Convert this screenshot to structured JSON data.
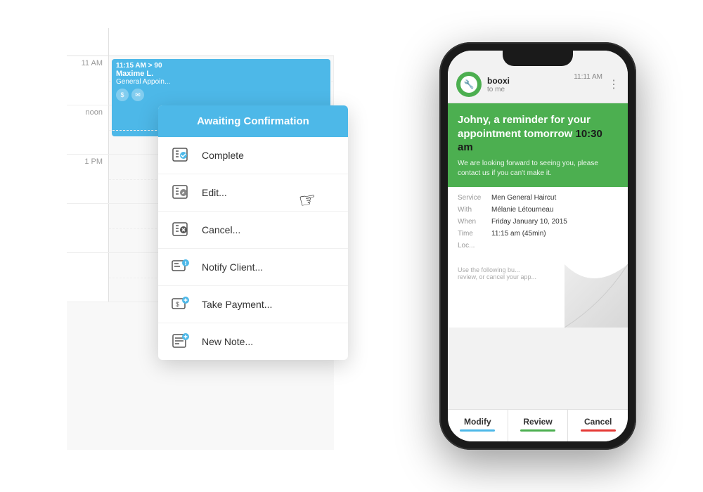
{
  "calendar": {
    "times": [
      "11 AM",
      "noon",
      "1 PM"
    ],
    "appointment": {
      "time": "11:15 AM > 90",
      "name": "Maxime L.",
      "desc": "General Appoin..."
    }
  },
  "contextMenu": {
    "header": "Awaiting Confirmation",
    "items": [
      {
        "id": "complete",
        "label": "Complete",
        "icon": "calendar-check"
      },
      {
        "id": "edit",
        "label": "Edit...",
        "icon": "calendar-edit"
      },
      {
        "id": "cancel",
        "label": "Cancel...",
        "icon": "calendar-cancel"
      },
      {
        "id": "notify",
        "label": "Notify Client...",
        "icon": "calendar-notify"
      },
      {
        "id": "payment",
        "label": "Take Payment...",
        "icon": "calendar-payment"
      },
      {
        "id": "note",
        "label": "New Note...",
        "icon": "calendar-note"
      }
    ]
  },
  "phone": {
    "sender": {
      "name": "booxi",
      "to": "to me",
      "time": "11:11 AM",
      "moreIcon": "⋮"
    },
    "banner": {
      "title_pre": "Johny, a reminder for your appointment tomorrow ",
      "time": "10:30 am",
      "subtitle": "We are looking forward to seeing you, please contact us if you can't make it."
    },
    "details": {
      "service_label": "Service",
      "service_value": "Men General Haircut",
      "with_label": "With",
      "with_value": "Mélanie Létourneau",
      "when_label": "When",
      "when_value": "Friday   January 10, 2015",
      "time_label": "Time",
      "time_value": "11:15 am (45min)",
      "loc_label": "Loc..."
    },
    "curl_text": "Use the following bu...\nreview, or cancel your app...",
    "buttons": [
      {
        "id": "modify",
        "label": "Modify",
        "color": "blue"
      },
      {
        "id": "review",
        "label": "Review",
        "color": "green"
      },
      {
        "id": "cancel",
        "label": "Cancel",
        "color": "red"
      }
    ]
  }
}
